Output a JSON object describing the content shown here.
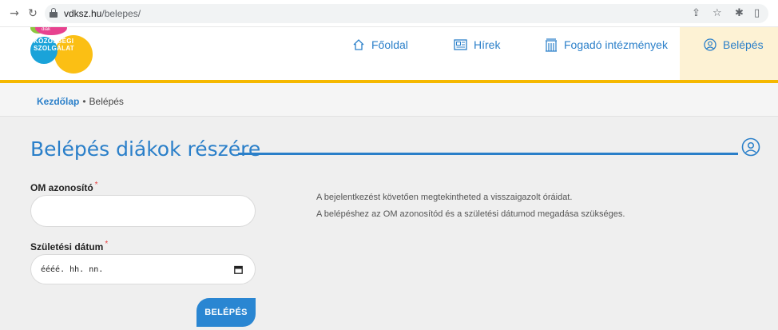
{
  "browser": {
    "url_domain": "vdksz.hu",
    "url_path": "/belepes/"
  },
  "logo": {
    "line1": "diák",
    "line2": "KÖZÖSSÉGI",
    "line3": "SZOLGÁLAT"
  },
  "nav": {
    "items": [
      {
        "label": "Főoldal",
        "icon": "home-icon"
      },
      {
        "label": "Hírek",
        "icon": "newspaper-icon"
      },
      {
        "label": "Fogadó intézmények",
        "icon": "building-icon"
      },
      {
        "label": "Belépés",
        "icon": "user-circle-icon",
        "active": true
      }
    ]
  },
  "breadcrumb": {
    "home": "Kezdőlap",
    "separator": "•",
    "current": "Belépés"
  },
  "page": {
    "title": "Belépés diákok részére"
  },
  "form": {
    "om_label": "OM azonosító",
    "om_value": "",
    "birth_label": "Születési dátum",
    "birth_placeholder": "éééé. hh. nn.",
    "required_mark": "*",
    "submit_label": "BELÉPÉS"
  },
  "info": {
    "line1": "A bejelentkezést követően megtekintheted a visszaigazolt óráidat.",
    "line2": "A belépéshez az OM azonosítód és a születési dátumod megadása szükséges."
  },
  "colors": {
    "accent": "#2a7fc9",
    "header_border": "#f5b800",
    "active_nav_bg": "#fdf2d4"
  }
}
